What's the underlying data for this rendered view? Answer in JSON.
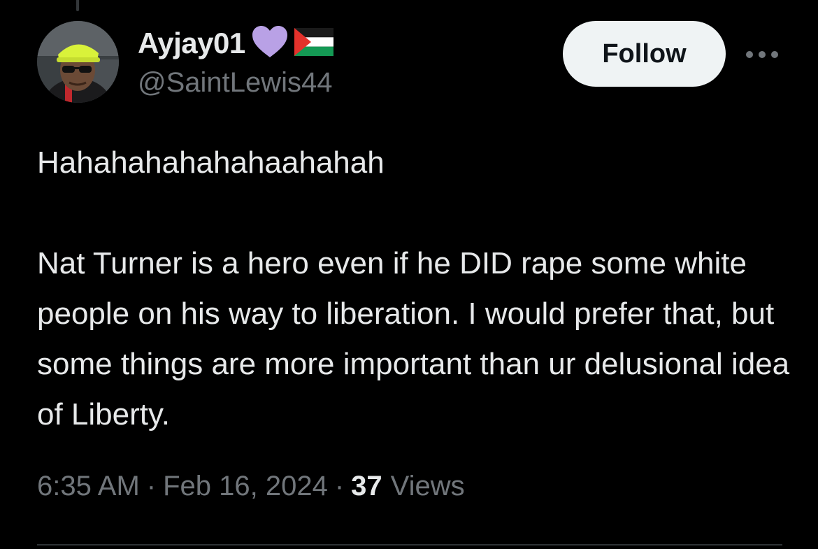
{
  "author": {
    "display_name": "Ayjay01",
    "handle": "@SaintLewis44",
    "name_emojis": [
      "purple-heart-icon",
      "palestine-flag-icon"
    ]
  },
  "actions": {
    "follow_label": "Follow",
    "more_icon": "more-horizontal-icon"
  },
  "tweet": {
    "text": "Hahahahahahahaahahah\n\nNat Turner is a hero even if he DID rape some white people on his way to liberation. I would prefer that, but some things are more important than ur delusional idea of Liberty.",
    "time": "6:35 AM",
    "separator": "·",
    "date": "Feb 16, 2024",
    "views_count": "37",
    "views_label": "Views"
  },
  "colors": {
    "background": "#000000",
    "primary_text": "#e7e9ea",
    "secondary_text": "#71767b",
    "follow_button_bg": "#eff3f4",
    "follow_button_text": "#0f1419",
    "purple_heart": "#b9a1e6",
    "divider": "#2f3336"
  }
}
